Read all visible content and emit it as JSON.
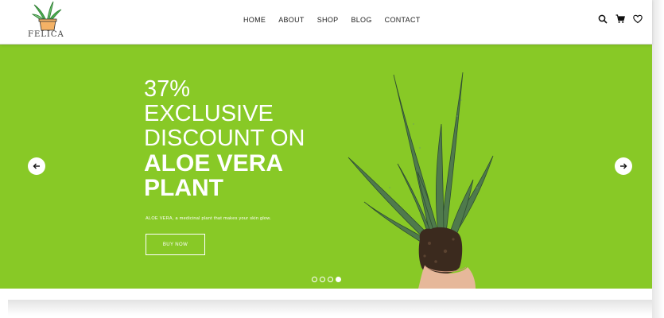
{
  "brand": {
    "name": "FELICA",
    "logo_icon": "plant-pot-logo"
  },
  "nav": {
    "items": [
      "HOME",
      "ABOUT",
      "SHOP",
      "BLOG",
      "CONTACT"
    ]
  },
  "header_icons": [
    "search-icon",
    "cart-icon",
    "heart-icon"
  ],
  "hero": {
    "line1": "37%",
    "line2": "EXCLUSIVE",
    "line3": "DISCOUNT ON",
    "line4": "ALOE VERA",
    "line5": "PLANT",
    "subtitle": "ALOE VERA, a medicinal plant that makes your skin glow.",
    "cta": "BUY NOW",
    "background": "#88c926"
  },
  "slider": {
    "slides": 4,
    "active": 4
  }
}
